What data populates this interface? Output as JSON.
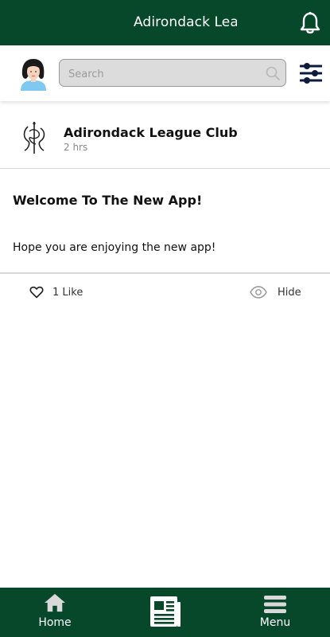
{
  "header": {
    "title": "Adirondack League Club",
    "notification_icon": "bell-icon"
  },
  "search": {
    "placeholder": "Search",
    "icon": "search-icon",
    "filter_icon": "sliders-icon",
    "avatar": "user-avatar"
  },
  "post": {
    "author": "Adirondack League Club",
    "time": "2 hrs",
    "title": "Welcome To The New App!",
    "body": "Hope you are enjoying the new app!",
    "like_label": "1 Like",
    "hide_label": "Hide"
  },
  "nav": {
    "home_label": "Home",
    "news_icon": "newspaper-icon",
    "menu_label": "Menu"
  },
  "colors": {
    "brand": "#07472a",
    "accent_icon": "#0f1b3d"
  }
}
